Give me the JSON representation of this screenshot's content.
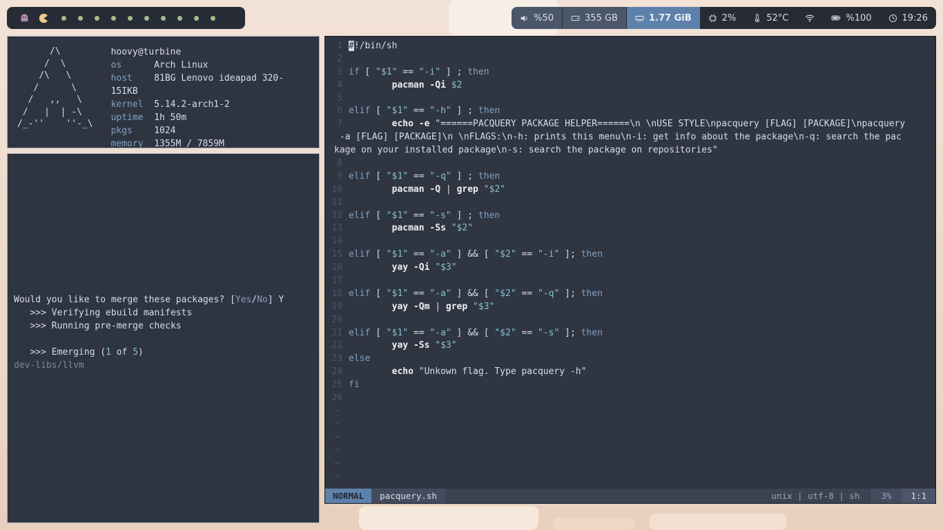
{
  "colors": {
    "accent_blue": "#81a1c1",
    "cyan": "#88c0d0",
    "workspace_dot_green": "#a3be8c",
    "bar_highlight_blue": "#5e81ac",
    "ghost_purple": "#b48ead",
    "pacman_yellow": "#ebcb8b"
  },
  "topbar": {
    "left_icons": [
      "ghost-icon",
      "pacman-icon"
    ],
    "workspaces": {
      "dot_count": 10
    },
    "right_segments": [
      {
        "id": "volume",
        "icon": "speaker-icon",
        "label": "%50",
        "style": "chip-light"
      },
      {
        "id": "disk",
        "icon": "disk-icon",
        "label": "355 GB",
        "style": "chip-light"
      },
      {
        "id": "memory",
        "icon": "ram-icon",
        "label": "1.77 GiB",
        "style": "chip-accent"
      },
      {
        "id": "cpu",
        "icon": "cpu-icon",
        "label": "2%",
        "style": "plain"
      },
      {
        "id": "temperature",
        "icon": "thermometer-icon",
        "label": "52°C",
        "style": "plain"
      },
      {
        "id": "wifi",
        "icon": "wifi-icon",
        "label": "",
        "style": "plain"
      },
      {
        "id": "battery",
        "icon": "battery-icon",
        "label": "%100",
        "style": "plain"
      },
      {
        "id": "clock",
        "icon": "clock-icon",
        "label": "19:26",
        "style": "plain"
      }
    ]
  },
  "neofetch": {
    "ascii_lines": [
      "      /\\",
      "     /  \\",
      "    /\\   \\",
      "   /      \\",
      "  /   ,,   \\",
      " /   |  | -\\",
      "/_-''    ''-_\\"
    ],
    "user_host": "hoovy@turbine",
    "fields": [
      {
        "label": "os",
        "value": "Arch Linux"
      },
      {
        "label": "host",
        "value": "81BG Lenovo ideapad 320-15IKB"
      },
      {
        "label": "kernel",
        "value": "5.14.2-arch1-2"
      },
      {
        "label": "uptime",
        "value": "1h 50m"
      },
      {
        "label": "pkgs",
        "value": "1024"
      },
      {
        "label": "memory",
        "value": "1355M / 7859M"
      }
    ]
  },
  "terminal": {
    "lines": [
      {
        "seg": [
          {
            "t": "Would you like to merge these packages? [",
            "c": "f"
          },
          {
            "t": "Yes",
            "c": "k"
          },
          {
            "t": "/",
            "c": "f"
          },
          {
            "t": "No",
            "c": "k"
          },
          {
            "t": "] Y",
            "c": "f"
          }
        ]
      },
      {
        "seg": [
          {
            "t": "   >>> Verifying ebuild manifests",
            "c": "f"
          }
        ]
      },
      {
        "seg": [
          {
            "t": "   >>> Running pre-merge checks",
            "c": "f"
          }
        ]
      },
      {
        "seg": []
      },
      {
        "seg": [
          {
            "t": "   >>> Emerging (",
            "c": "f"
          },
          {
            "t": "1",
            "c": "v"
          },
          {
            "t": " of ",
            "c": "f"
          },
          {
            "t": "5",
            "c": "v"
          },
          {
            "t": ")",
            "c": "f"
          }
        ]
      },
      {
        "seg": [
          {
            "t": "dev-libs/llvm",
            "c": "d"
          }
        ]
      }
    ]
  },
  "editor": {
    "rows": [
      {
        "n": "1",
        "seg": [
          {
            "t": "#",
            "c": "cur"
          },
          {
            "t": "!/bin/sh",
            "c": "f"
          }
        ]
      },
      {
        "n": "2",
        "seg": []
      },
      {
        "n": "3",
        "seg": [
          {
            "t": "if ",
            "c": "k"
          },
          {
            "t": "[ ",
            "c": "f"
          },
          {
            "t": "\"$1\"",
            "c": "v"
          },
          {
            "t": " == ",
            "c": "f"
          },
          {
            "t": "\"-i\"",
            "c": "v"
          },
          {
            "t": " ] ; ",
            "c": "f"
          },
          {
            "t": "then",
            "c": "k"
          }
        ]
      },
      {
        "n": "4",
        "seg": [
          {
            "t": "        ",
            "c": "f"
          },
          {
            "t": "pacman -Qi ",
            "c": "c"
          },
          {
            "t": "$2",
            "c": "v"
          }
        ]
      },
      {
        "n": "5",
        "seg": []
      },
      {
        "n": "6",
        "seg": [
          {
            "t": "elif ",
            "c": "k"
          },
          {
            "t": "[ ",
            "c": "f"
          },
          {
            "t": "\"$1\"",
            "c": "v"
          },
          {
            "t": " == ",
            "c": "f"
          },
          {
            "t": "\"-h\"",
            "c": "v"
          },
          {
            "t": " ] ; ",
            "c": "f"
          },
          {
            "t": "then",
            "c": "k"
          }
        ]
      },
      {
        "n": "7",
        "seg": [
          {
            "t": "        ",
            "c": "f"
          },
          {
            "t": "echo -e ",
            "c": "c"
          },
          {
            "t": "\"======PACQUERY PACKAGE HELPER======\\n \\nUSE STYLE\\npacquery [FLAG] [PACKAGE]\\npacquery",
            "c": "f"
          }
        ]
      },
      {
        "n": "",
        "wrap": true,
        "seg": [
          {
            "t": " -a [FLAG] [PACKAGE]\\n \\nFLAGS:\\n-h: prints this menu\\n-i: get info about the package\\n-q: search the pac",
            "c": "f"
          }
        ]
      },
      {
        "n": "",
        "wrap": true,
        "seg": [
          {
            "t": "kage on your installed package\\n-s: search the package on repositories\"",
            "c": "f"
          }
        ]
      },
      {
        "n": "8",
        "seg": []
      },
      {
        "n": "9",
        "seg": [
          {
            "t": "elif ",
            "c": "k"
          },
          {
            "t": "[ ",
            "c": "f"
          },
          {
            "t": "\"$1\"",
            "c": "v"
          },
          {
            "t": " == ",
            "c": "f"
          },
          {
            "t": "\"-q\"",
            "c": "v"
          },
          {
            "t": " ] ; ",
            "c": "f"
          },
          {
            "t": "then",
            "c": "k"
          }
        ]
      },
      {
        "n": "10",
        "seg": [
          {
            "t": "        ",
            "c": "f"
          },
          {
            "t": "pacman -Q ",
            "c": "c"
          },
          {
            "t": "| ",
            "c": "f"
          },
          {
            "t": "grep ",
            "c": "c"
          },
          {
            "t": "\"$2\"",
            "c": "v"
          }
        ]
      },
      {
        "n": "11",
        "seg": []
      },
      {
        "n": "12",
        "seg": [
          {
            "t": "elif ",
            "c": "k"
          },
          {
            "t": "[ ",
            "c": "f"
          },
          {
            "t": "\"$1\"",
            "c": "v"
          },
          {
            "t": " == ",
            "c": "f"
          },
          {
            "t": "\"-s\"",
            "c": "v"
          },
          {
            "t": " ] ; ",
            "c": "f"
          },
          {
            "t": "then",
            "c": "k"
          }
        ]
      },
      {
        "n": "13",
        "seg": [
          {
            "t": "        ",
            "c": "f"
          },
          {
            "t": "pacman -Ss ",
            "c": "c"
          },
          {
            "t": "\"$2\"",
            "c": "v"
          }
        ]
      },
      {
        "n": "14",
        "seg": []
      },
      {
        "n": "15",
        "seg": [
          {
            "t": "elif ",
            "c": "k"
          },
          {
            "t": "[ ",
            "c": "f"
          },
          {
            "t": "\"$1\"",
            "c": "v"
          },
          {
            "t": " == ",
            "c": "f"
          },
          {
            "t": "\"-a\"",
            "c": "v"
          },
          {
            "t": " ] && [ ",
            "c": "f"
          },
          {
            "t": "\"$2\"",
            "c": "v"
          },
          {
            "t": " == ",
            "c": "f"
          },
          {
            "t": "\"-i\"",
            "c": "v"
          },
          {
            "t": " ]; ",
            "c": "f"
          },
          {
            "t": "then",
            "c": "k"
          }
        ]
      },
      {
        "n": "16",
        "seg": [
          {
            "t": "        ",
            "c": "f"
          },
          {
            "t": "yay -Qi ",
            "c": "c"
          },
          {
            "t": "\"$3\"",
            "c": "v"
          }
        ]
      },
      {
        "n": "17",
        "seg": []
      },
      {
        "n": "18",
        "seg": [
          {
            "t": "elif ",
            "c": "k"
          },
          {
            "t": "[ ",
            "c": "f"
          },
          {
            "t": "\"$1\"",
            "c": "v"
          },
          {
            "t": " == ",
            "c": "f"
          },
          {
            "t": "\"-a\"",
            "c": "v"
          },
          {
            "t": " ] && [ ",
            "c": "f"
          },
          {
            "t": "\"$2\"",
            "c": "v"
          },
          {
            "t": " == ",
            "c": "f"
          },
          {
            "t": "\"-q\"",
            "c": "v"
          },
          {
            "t": " ]; ",
            "c": "f"
          },
          {
            "t": "then",
            "c": "k"
          }
        ]
      },
      {
        "n": "19",
        "seg": [
          {
            "t": "        ",
            "c": "f"
          },
          {
            "t": "yay -Qm ",
            "c": "c"
          },
          {
            "t": "| ",
            "c": "f"
          },
          {
            "t": "grep ",
            "c": "c"
          },
          {
            "t": "\"$3\"",
            "c": "v"
          }
        ]
      },
      {
        "n": "20",
        "seg": []
      },
      {
        "n": "21",
        "seg": [
          {
            "t": "elif ",
            "c": "k"
          },
          {
            "t": "[ ",
            "c": "f"
          },
          {
            "t": "\"$1\"",
            "c": "v"
          },
          {
            "t": " == ",
            "c": "f"
          },
          {
            "t": "\"-a\"",
            "c": "v"
          },
          {
            "t": " ] && [ ",
            "c": "f"
          },
          {
            "t": "\"$2\"",
            "c": "v"
          },
          {
            "t": " == ",
            "c": "f"
          },
          {
            "t": "\"-s\"",
            "c": "v"
          },
          {
            "t": " ]; ",
            "c": "f"
          },
          {
            "t": "then",
            "c": "k"
          }
        ]
      },
      {
        "n": "22",
        "seg": [
          {
            "t": "        ",
            "c": "f"
          },
          {
            "t": "yay -Ss ",
            "c": "c"
          },
          {
            "t": "\"$3\"",
            "c": "v"
          }
        ]
      },
      {
        "n": "23",
        "seg": [
          {
            "t": "else",
            "c": "k"
          }
        ]
      },
      {
        "n": "24",
        "seg": [
          {
            "t": "        ",
            "c": "f"
          },
          {
            "t": "echo ",
            "c": "c"
          },
          {
            "t": "\"Unkown flag. Type pacquery -h\"",
            "c": "f"
          }
        ]
      },
      {
        "n": "25",
        "seg": [
          {
            "t": "fi",
            "c": "k"
          }
        ]
      },
      {
        "n": "26",
        "seg": []
      }
    ],
    "tilde_count": 6,
    "tilde_char": "~",
    "statusline": {
      "mode": "NORMAL",
      "filename": "pacquery.sh",
      "format": "unix | utf-8 | sh",
      "scroll_percent": "3%",
      "cursor_position": "1:1"
    }
  }
}
